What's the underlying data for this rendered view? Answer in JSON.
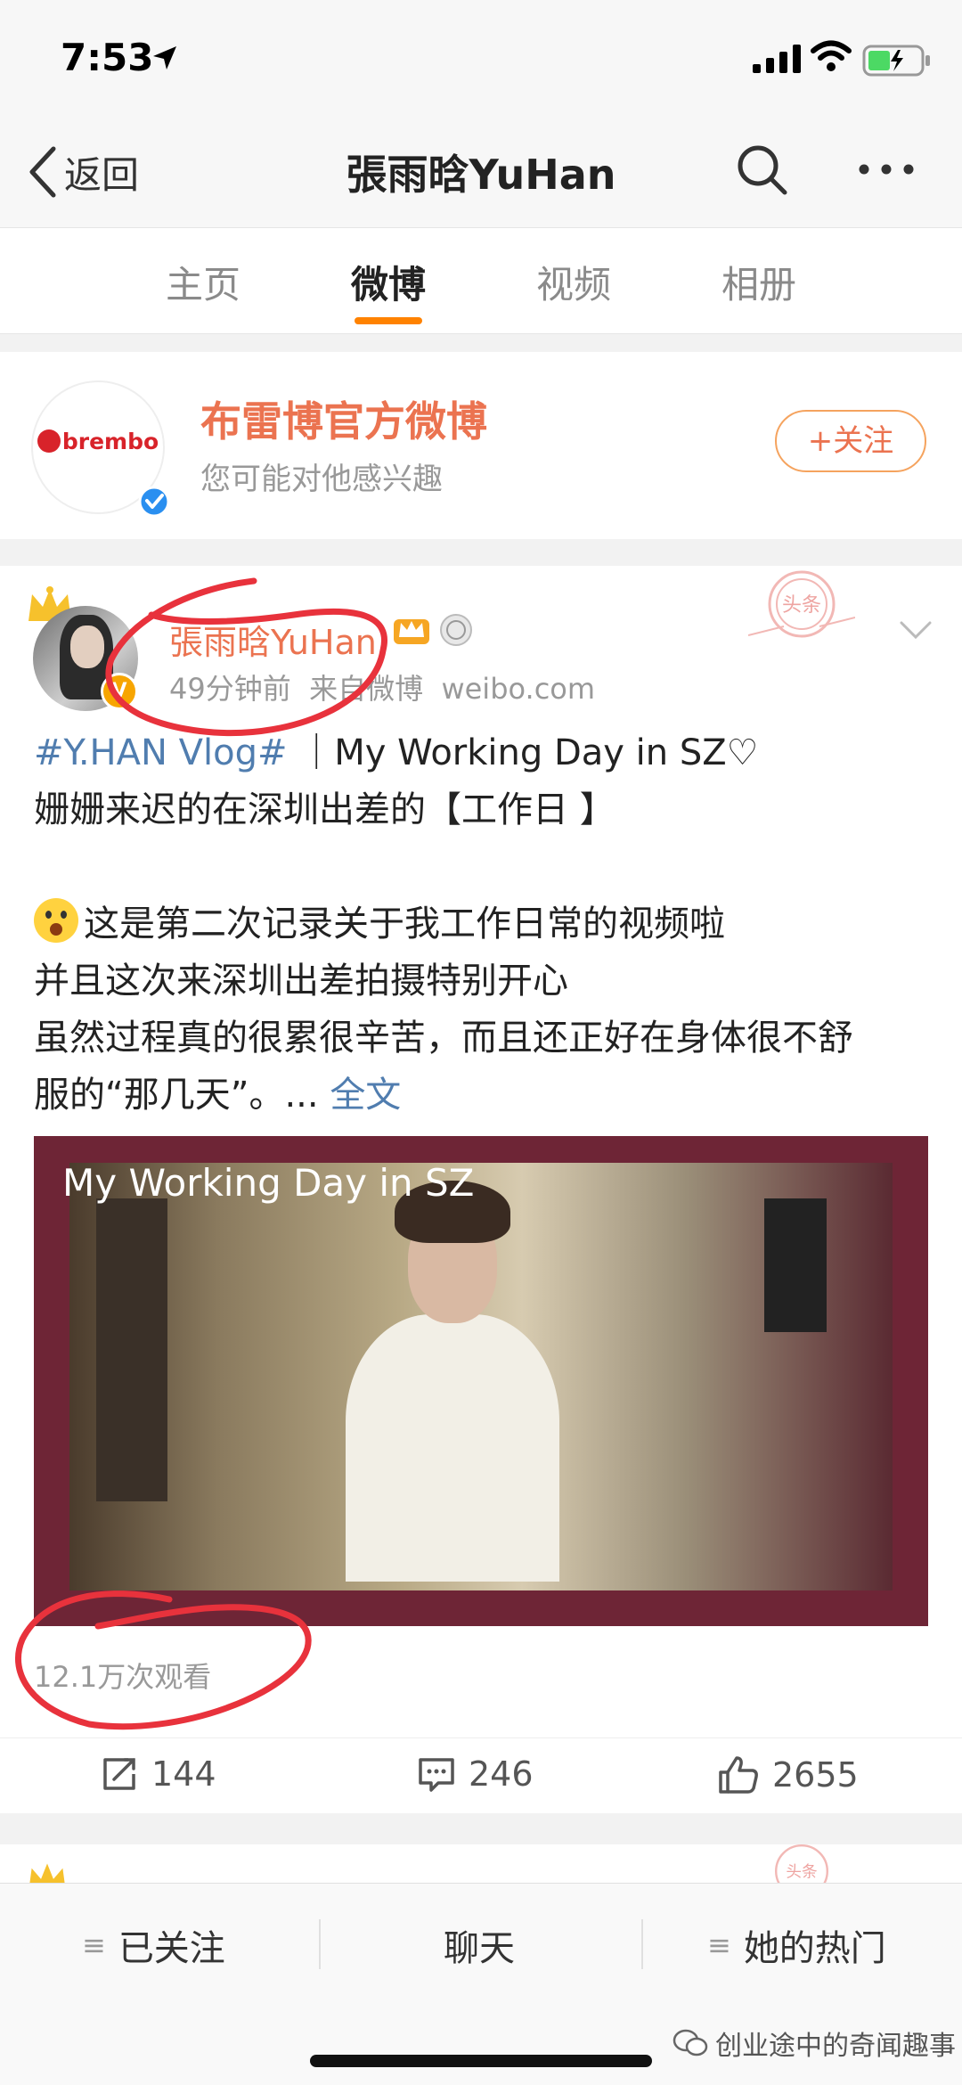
{
  "status_bar": {
    "time": "7:53"
  },
  "nav": {
    "back_label": "返回",
    "title": "張雨晗YuHan"
  },
  "tabs": [
    {
      "label": "主页"
    },
    {
      "label": "微博"
    },
    {
      "label": "视频"
    },
    {
      "label": "相册"
    }
  ],
  "suggestion": {
    "logo_text": "brembo",
    "name": "布雷博官方微博",
    "hint": "您可能对他感兴趣",
    "follow_label": "+关注"
  },
  "post": {
    "author": "張雨晗YuHan",
    "time": "49分钟前",
    "source": "来自微博",
    "source_site": "weibo.com",
    "stamp_text": "头条",
    "topic": "#Y.HAN Vlog#",
    "title_line": "｜My Working Day in SZ♡",
    "line2": "姗姗来迟的在深圳出差的【工作日 】",
    "line4": "这是第二次记录关于我工作日常的视频啦",
    "line5": "并且这次来深圳出差拍摄特别开心",
    "line6": "虽然过程真的很累很辛苦，而且还正好在身体很不舒",
    "line7": "服的“那几天”。...",
    "full_text_link": "全文",
    "video_title": "My Working Day in SZ",
    "views": "12.1万次观看",
    "reposts": "144",
    "comments": "246",
    "likes": "2655"
  },
  "toolbar": {
    "followed": "已关注",
    "chat": "聊天",
    "hot": "她的热门",
    "watermark": "创业途中的奇闻趣事"
  },
  "colors": {
    "accent": "#ff8200",
    "name_orange": "#eb7350",
    "link_blue": "#507daf",
    "annotation_red": "#e8323c"
  }
}
